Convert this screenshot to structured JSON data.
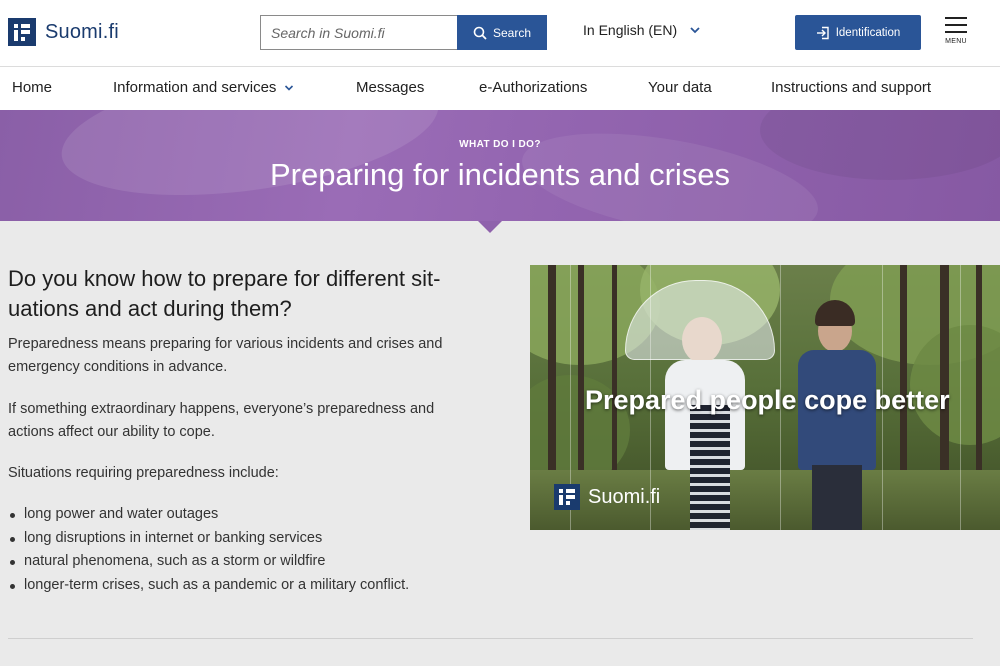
{
  "header": {
    "logo_text": "Suomi.fi",
    "search_placeholder": "Search in Suomi.fi",
    "search_button": "Search",
    "language": "In English (EN)",
    "identification_button": "Identification",
    "menu_label": "MENU"
  },
  "nav": {
    "items": [
      {
        "label": "Home"
      },
      {
        "label": "Information and services",
        "has_dropdown": true
      },
      {
        "label": "Messages"
      },
      {
        "label": "e-Authorizations"
      },
      {
        "label": "Your data"
      },
      {
        "label": "Instructions and support"
      }
    ]
  },
  "hero": {
    "kicker": "WHAT DO I DO?",
    "title": "Preparing for incidents and crises",
    "color": "#9365b0"
  },
  "content": {
    "heading_line1": "Do you know how to prepare for different sit-",
    "heading_line2": "uations and act during them?",
    "paragraphs": [
      "Preparedness means preparing for various incidents and crises and emergency conditions in advance.",
      "If something extraordinary happens, everyone’s preparedness and actions affect our ability to cope.",
      "Situations requiring preparedness include:"
    ],
    "list": [
      "long power and water outages",
      "long disruptions in internet or banking services",
      "natural phenomena, such as a storm or wildfire",
      "longer-term crises, such as a pandemic or a military conflict."
    ]
  },
  "image": {
    "caption": "Prepared people cope better",
    "logo_text": "Suomi.fi"
  },
  "colors": {
    "brand_blue": "#1a3b6e",
    "button_blue": "#2a5597"
  },
  "icons": [
    "suomi-logo-icon",
    "search-icon",
    "chevron-down-icon",
    "login-icon",
    "hamburger-icon"
  ]
}
